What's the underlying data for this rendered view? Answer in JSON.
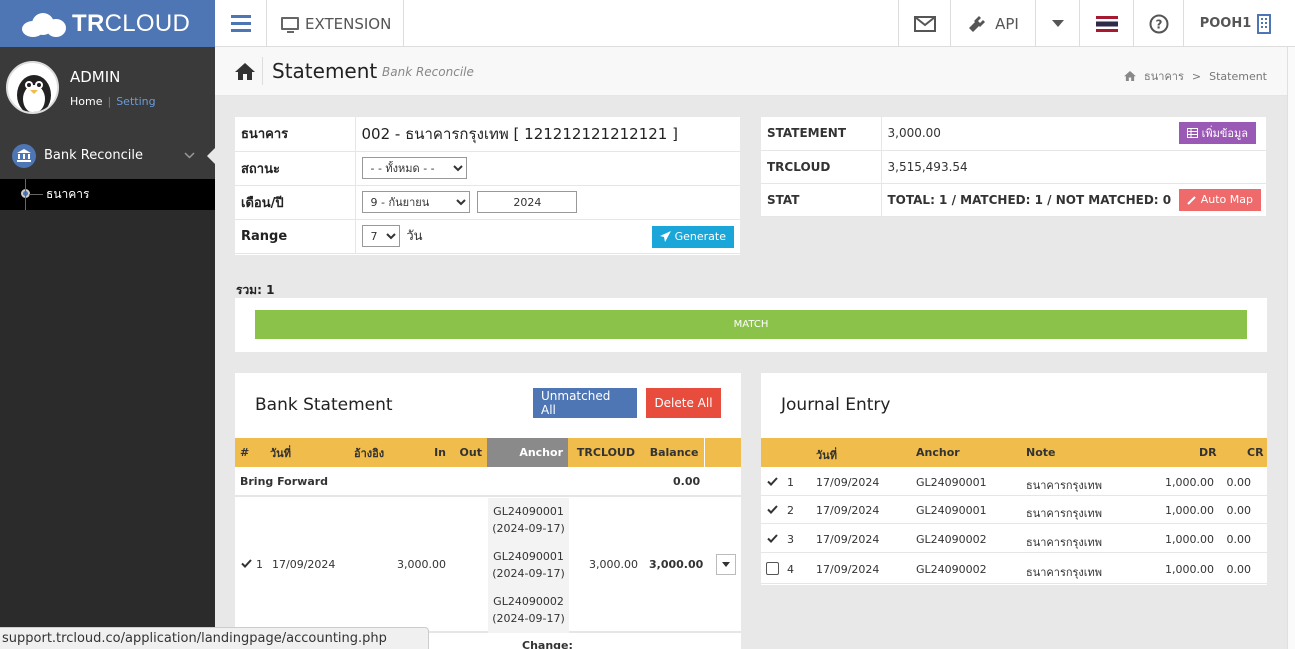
{
  "app": {
    "logo_bold": "TR",
    "logo_light": "CLOUD",
    "extension_label": "EXTENSION",
    "api_label": "API",
    "user_label": "POOH1"
  },
  "sidebar": {
    "user_name": "ADMIN",
    "home_link": "Home",
    "setting_link": "Setting",
    "menu_item": "Bank Reconcile",
    "sub_item": "ธนาคาร"
  },
  "page": {
    "title": "Statement",
    "subtitle": "Bank Reconcile",
    "breadcrumb_1": "ธนาคาร",
    "breadcrumb_sep": ">",
    "breadcrumb_2": "Statement"
  },
  "form": {
    "bank_label": "ธนาคาร",
    "bank_value": "002 - ธนาคารกรุงเทพ [ 121212121212121 ]",
    "status_label": "สถานะ",
    "status_value": "- - ทั้งหมด - -",
    "month_label": "เดือน/ปี",
    "month_value": "9 - กันยายน",
    "year_value": "2024",
    "range_label": "Range",
    "range_value": "7",
    "range_unit": "วัน",
    "generate_button": "Generate"
  },
  "stats": {
    "statement_label": "STATEMENT",
    "statement_value": "3,000.00",
    "add_button": "เพิ่มข้อมูล",
    "trcloud_label": "TRCLOUD",
    "trcloud_value": "3,515,493.54",
    "stat_label": "STAT",
    "stat_value": "TOTAL: 1 / MATCHED: 1 / NOT MATCHED: 0",
    "automap_button": "Auto Map"
  },
  "summary": {
    "sum_label": "รวม: 1",
    "match_bar": "MATCH"
  },
  "bank_statement": {
    "title": "Bank Statement",
    "unmatched_button": "Unmatched All",
    "delete_button": "Delete All",
    "columns": [
      "#",
      "วันที่",
      "อ้างอิง",
      "In",
      "Out",
      "Anchor",
      "TRCLOUD",
      "Balance"
    ],
    "bring_forward_label": "Bring Forward",
    "bring_forward_balance": "0.00",
    "row": {
      "index": "1",
      "date": "17/09/2024",
      "in": "3,000.00",
      "trcloud": "3,000.00",
      "balance": "3,000.00",
      "anchors": [
        {
          "code": "GL24090001",
          "date": "(2024-09-17)"
        },
        {
          "code": "GL24090001",
          "date": "(2024-09-17)"
        },
        {
          "code": "GL24090002",
          "date": "(2024-09-17)"
        }
      ]
    },
    "next_row_label": "Change:"
  },
  "journal": {
    "title": "Journal Entry",
    "columns": [
      "วันที่",
      "Anchor",
      "Note",
      "DR",
      "CR"
    ],
    "rows": [
      {
        "index": "1",
        "checked": true,
        "date": "17/09/2024",
        "anchor": "GL24090001",
        "note": "ธนาคารกรุงเทพ",
        "dr": "1,000.00",
        "cr": "0.00"
      },
      {
        "index": "2",
        "checked": true,
        "date": "17/09/2024",
        "anchor": "GL24090001",
        "note": "ธนาคารกรุงเทพ",
        "dr": "1,000.00",
        "cr": "0.00"
      },
      {
        "index": "3",
        "checked": true,
        "date": "17/09/2024",
        "anchor": "GL24090002",
        "note": "ธนาคารกรุงเทพ",
        "dr": "1,000.00",
        "cr": "0.00"
      },
      {
        "index": "4",
        "checked": false,
        "date": "17/09/2024",
        "anchor": "GL24090002",
        "note": "ธนาคารกรุงเทพ",
        "dr": "1,000.00",
        "cr": "0.00"
      }
    ]
  },
  "statusbar": {
    "url": "support.trcloud.co/application/landingpage/accounting.php"
  },
  "colors": {
    "brand": "#4e75b4",
    "match": "#8bc34a",
    "header": "#f0bc4b",
    "generate": "#1aa6d9",
    "automap": "#ef6a6a",
    "add": "#9b59b6",
    "unmatched": "#4e75b4",
    "delete": "#e74c3c"
  }
}
